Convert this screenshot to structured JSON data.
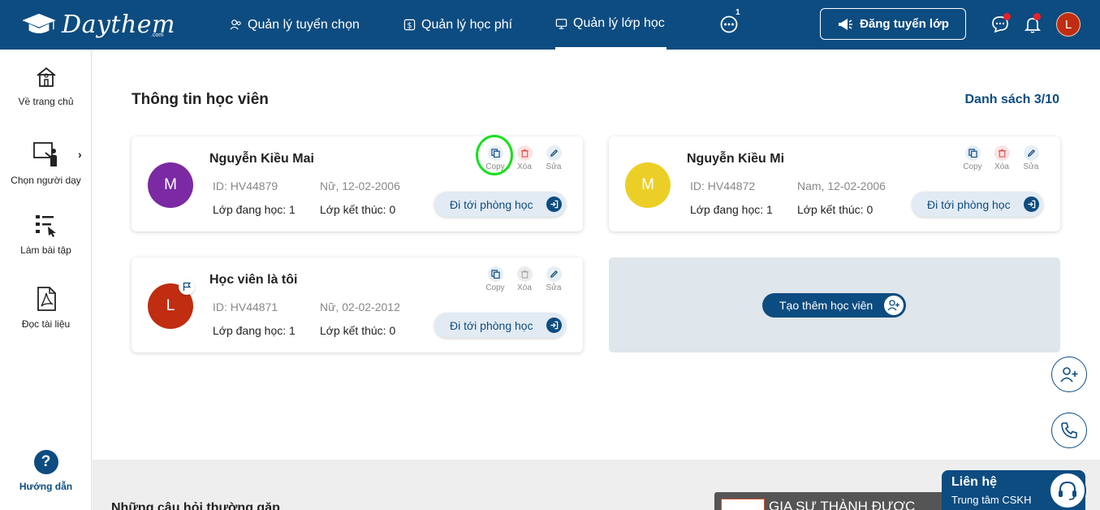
{
  "header": {
    "logo_text": "Daythem",
    "logo_sub": ".com",
    "nav": [
      {
        "label": "Quản lý tuyển chọn",
        "icon": "users-icon"
      },
      {
        "label": "Quản lý học phí",
        "icon": "dollar-icon"
      },
      {
        "label": "Quản lý lớp học",
        "icon": "monitor-icon",
        "active": true
      }
    ],
    "more_badge": "1",
    "post_button": "Đăng tuyển lớp",
    "avatar_letter": "L"
  },
  "sidebar": {
    "items": [
      {
        "label": "Về trang chủ",
        "icon": "home-icon"
      },
      {
        "label": "Chọn người dạy",
        "icon": "teacher-board-icon"
      },
      {
        "label": "Làm bài tập",
        "icon": "checklist-icon"
      },
      {
        "label": "Đọc tài liệu",
        "icon": "pdf-icon"
      }
    ],
    "help_label": "Hướng dẫn"
  },
  "main": {
    "title": "Thông tin học viên",
    "list_count": "Danh sách 3/10",
    "actions": {
      "copy": "Copy",
      "delete": "Xóa",
      "edit": "Sửa"
    },
    "go_button": "Đi tới phòng học",
    "add_button": "Tạo thêm học viên",
    "students": [
      {
        "avatar": "M",
        "color": "#7b2aa3",
        "name": "Nguyễn Kiều Mai",
        "id": "ID: HV44879",
        "dob": "Nữ, 12-02-2006",
        "learning": "Lớp đang học: 1",
        "done": "Lớp kết thúc: 0"
      },
      {
        "avatar": "M",
        "color": "#eccf26",
        "name": "Nguyễn Kiều Mi",
        "id": "ID: HV44872",
        "dob": "Nam, 12-02-2006",
        "learning": "Lớp đang học: 1",
        "done": "Lớp kết thúc: 0"
      },
      {
        "avatar": "L",
        "color": "#c02d10",
        "name": "Học viên là tôi",
        "id": "ID: HV44871",
        "dob": "Nữ, 02-02-2012",
        "learning": "Lớp đang học: 1",
        "done": "Lớp kết thúc: 0"
      }
    ]
  },
  "faq": {
    "title": "Những câu hỏi thường gặp"
  },
  "promo": {
    "text": "GIA SƯ THÀNH ĐƯỢC"
  },
  "contact": {
    "title": "Liên hệ",
    "subtitle": "Trung tâm CSKH"
  },
  "colors": {
    "primary": "#0d4c80",
    "highlight": "#18e01e",
    "alert": "#e8202a"
  }
}
